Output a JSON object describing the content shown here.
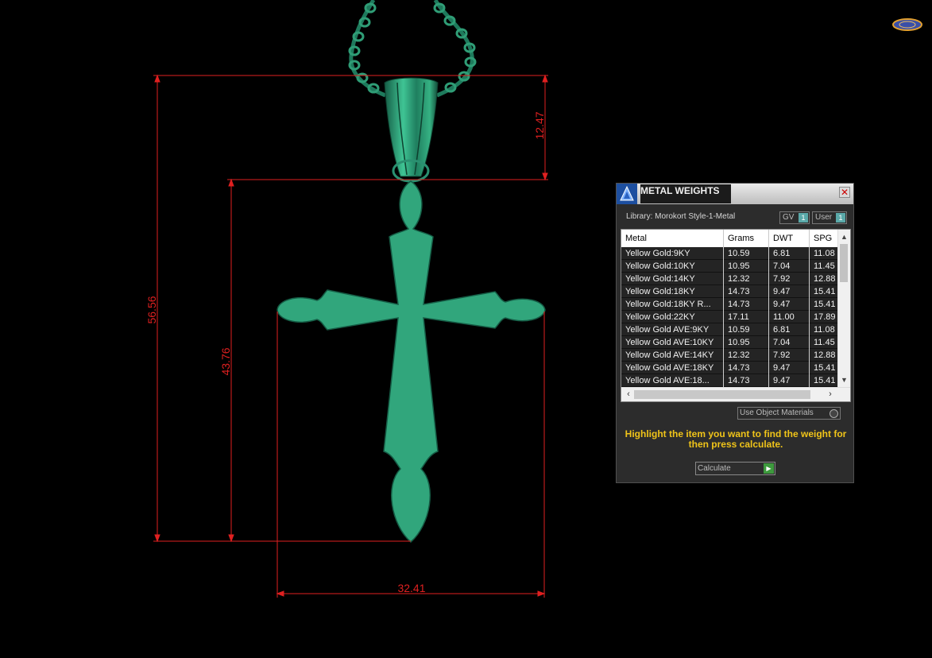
{
  "dimensions": {
    "overall_height": "56.56",
    "cross_height": "43.76",
    "bail_height": "12.47",
    "width": "32.41"
  },
  "colors": {
    "metal": "#2faa7f",
    "dimension_lines": "#e02020",
    "hint_text": "#f0c419"
  },
  "panel": {
    "title": "METAL WEIGHTS",
    "close": "✕",
    "library_label": "Library: Morokort Style-1-Metal",
    "gv_toggle": "GV",
    "user_toggle": "User",
    "toggle_value": "1",
    "columns": [
      "Metal",
      "Grams",
      "DWT",
      "SPG"
    ],
    "rows": [
      {
        "metal": "Yellow Gold:9KY",
        "grams": "10.59",
        "dwt": "6.81",
        "spg": "11.08"
      },
      {
        "metal": "Yellow Gold:10KY",
        "grams": "10.95",
        "dwt": "7.04",
        "spg": "11.45"
      },
      {
        "metal": "Yellow Gold:14KY",
        "grams": "12.32",
        "dwt": "7.92",
        "spg": "12.88"
      },
      {
        "metal": "Yellow Gold:18KY",
        "grams": "14.73",
        "dwt": "9.47",
        "spg": "15.41"
      },
      {
        "metal": "Yellow Gold:18KY R...",
        "grams": "14.73",
        "dwt": "9.47",
        "spg": "15.41"
      },
      {
        "metal": "Yellow Gold:22KY",
        "grams": "17.11",
        "dwt": "11.00",
        "spg": "17.89"
      },
      {
        "metal": "Yellow Gold AVE:9KY",
        "grams": "10.59",
        "dwt": "6.81",
        "spg": "11.08"
      },
      {
        "metal": "Yellow Gold AVE:10KY",
        "grams": "10.95",
        "dwt": "7.04",
        "spg": "11.45"
      },
      {
        "metal": "Yellow Gold AVE:14KY",
        "grams": "12.32",
        "dwt": "7.92",
        "spg": "12.88"
      },
      {
        "metal": "Yellow Gold AVE:18KY",
        "grams": "14.73",
        "dwt": "9.47",
        "spg": "15.41"
      },
      {
        "metal": "Yellow Gold AVE:18...",
        "grams": "14.73",
        "dwt": "9.47",
        "spg": "15.41"
      }
    ],
    "use_object_materials": "Use Object Materials",
    "hint": "Highlight the item you want to find the weight for then press calculate.",
    "calculate": "Calculate"
  }
}
